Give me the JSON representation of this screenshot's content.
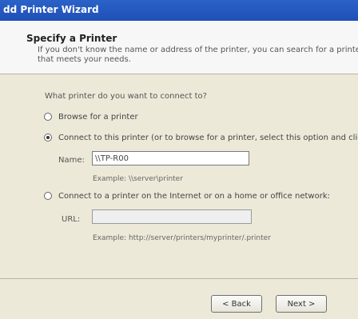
{
  "window": {
    "title": "dd Printer Wizard"
  },
  "header": {
    "title": "Specify a Printer",
    "description_lines": [
      "If you don't know the name or address of the printer, you can search for a printe",
      "that meets your needs."
    ]
  },
  "main": {
    "question": "What printer do you want to connect to?",
    "options": [
      {
        "label": "Browse for a printer",
        "selected": false
      },
      {
        "label": "Connect to this printer (or to browse for a printer, select this option and click",
        "selected": true
      },
      {
        "label": "Connect to a printer on the Internet or on a home or office network:",
        "selected": false
      }
    ],
    "name_field": {
      "label": "Name:",
      "value": "\\\\TP-R00",
      "example": "Example: \\\\server\\printer"
    },
    "url_field": {
      "label": "URL:",
      "value": "",
      "example": "Example: http://server/printers/myprinter/.printer"
    }
  },
  "footer": {
    "back_label": "< Back",
    "next_label": "Next >"
  }
}
